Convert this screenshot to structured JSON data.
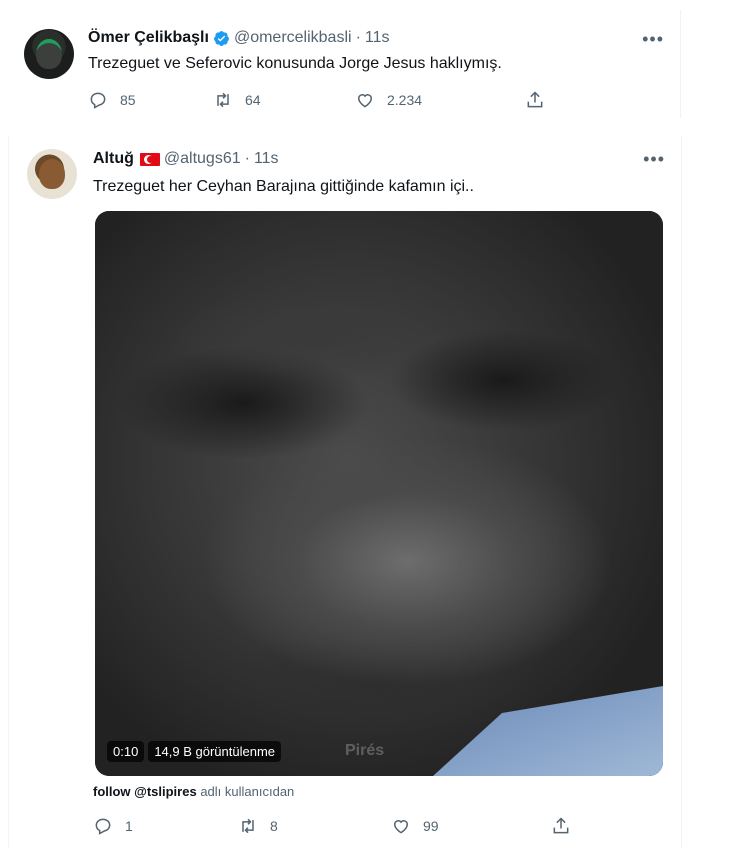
{
  "tweets": [
    {
      "name": "Ömer Çelikbaşlı",
      "handle": "@omercelikbasli",
      "time": "11s",
      "text": "Trezeguet ve Seferovic konusunda Jorge Jesus haklıymış.",
      "verified": true,
      "replies": "85",
      "retweets": "64",
      "likes": "2.234"
    },
    {
      "name": "Altuğ",
      "handle": "@altugs61",
      "time": "11s",
      "text": "Trezeguet her Ceyhan Barajına gittiğinde kafamın içi..",
      "flag": "TR",
      "media": {
        "duration": "0:10",
        "views": "14,9 B görüntülenme",
        "watermark": "Pirés"
      },
      "attribution_prefix": "follow @tslipires",
      "attribution_suffix": "adlı kullanıcıdan",
      "replies": "1",
      "retweets": "8",
      "likes": "99"
    }
  ],
  "separator": "·",
  "colors": {
    "text_primary": "#0f1419",
    "text_secondary": "#536471",
    "verified_blue": "#1d9bf0",
    "flag_red": "#e30a17"
  },
  "icons": [
    "verified-badge-icon",
    "more-icon",
    "reply-icon",
    "retweet-icon",
    "like-icon",
    "share-icon"
  ]
}
